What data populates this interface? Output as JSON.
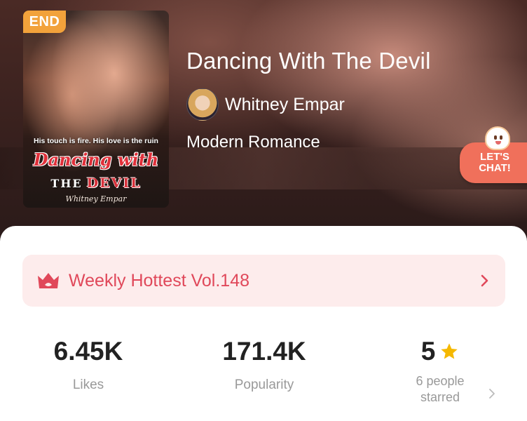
{
  "book": {
    "status_badge": "END",
    "title": "Dancing With The Devil",
    "author": "Whitney Empar",
    "genre": "Modern Romance"
  },
  "cover": {
    "tagline": "His touch is fire. His love is the ruin",
    "title_line1": "Dancing with",
    "title_the": "THE",
    "title_devil": "DEVIL",
    "author_script": "Whitney Empar"
  },
  "chat_bubble": {
    "line1": "LET'S",
    "line2": "CHAT!"
  },
  "ranking": {
    "label": "Weekly Hottest Vol.148",
    "icon": "crown-icon"
  },
  "stats": {
    "likes": {
      "value": "6.45K",
      "label": "Likes"
    },
    "popularity": {
      "value": "171.4K",
      "label": "Popularity"
    },
    "rating": {
      "value": "5",
      "label_line1": "6 people",
      "label_line2": "starred"
    }
  },
  "colors": {
    "accent_red": "#e0485a",
    "badge_orange": "#f2a23b",
    "chat_coral": "#f0705b",
    "star_yellow": "#f5b800",
    "banner_bg": "#fdecec"
  }
}
